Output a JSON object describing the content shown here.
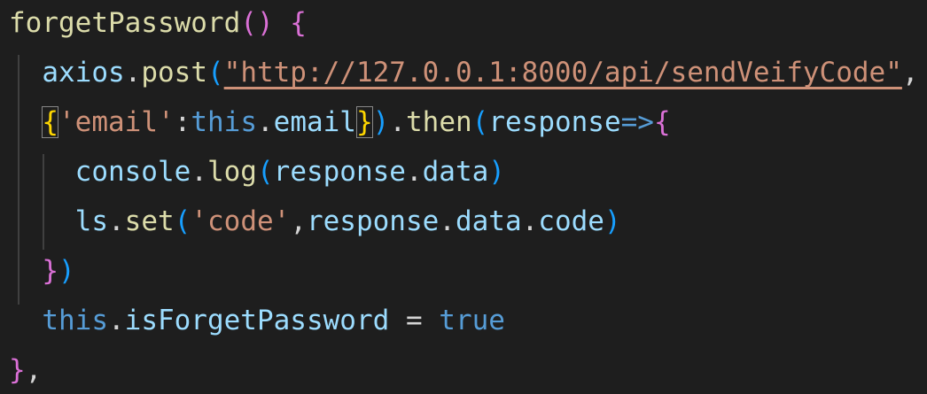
{
  "editor": {
    "lines": [
      {
        "tokens": [
          {
            "t": "forgetPassword",
            "c": "tok-fn"
          },
          {
            "t": "()",
            "c": "tok-b2"
          },
          {
            "t": " ",
            "c": "tok-punct"
          },
          {
            "t": "{",
            "c": "tok-b2"
          }
        ]
      },
      {
        "tokens": [
          {
            "t": "  ",
            "c": "tok-punct"
          },
          {
            "t": "axios",
            "c": "tok-var"
          },
          {
            "t": ".",
            "c": "tok-punct"
          },
          {
            "t": "post",
            "c": "tok-fn"
          },
          {
            "t": "(",
            "c": "tok-b3"
          },
          {
            "t": "\"http://127.0.0.1:8000/api/sendVeifyCode\"",
            "c": "tok-str-url"
          },
          {
            "t": ",",
            "c": "tok-punct"
          }
        ]
      },
      {
        "tokens": [
          {
            "t": "  ",
            "c": "tok-punct"
          },
          {
            "t": "{",
            "c": "tok-b1 bracket-match"
          },
          {
            "t": "'email'",
            "c": "tok-str"
          },
          {
            "t": ":",
            "c": "tok-punct"
          },
          {
            "t": "this",
            "c": "tok-kw"
          },
          {
            "t": ".",
            "c": "tok-punct"
          },
          {
            "t": "email",
            "c": "tok-var"
          },
          {
            "t": "}",
            "c": "tok-b1 bracket-match"
          },
          {
            "t": ")",
            "c": "tok-b3"
          },
          {
            "t": ".",
            "c": "tok-punct"
          },
          {
            "t": "then",
            "c": "tok-fn"
          },
          {
            "t": "(",
            "c": "tok-b3"
          },
          {
            "t": "response",
            "c": "tok-var"
          },
          {
            "t": "=>",
            "c": "tok-arrow"
          },
          {
            "t": "{",
            "c": "tok-b2"
          }
        ]
      },
      {
        "tokens": [
          {
            "t": "    ",
            "c": "tok-punct"
          },
          {
            "t": "console",
            "c": "tok-var"
          },
          {
            "t": ".",
            "c": "tok-punct"
          },
          {
            "t": "log",
            "c": "tok-fn"
          },
          {
            "t": "(",
            "c": "tok-b3"
          },
          {
            "t": "response",
            "c": "tok-var"
          },
          {
            "t": ".",
            "c": "tok-punct"
          },
          {
            "t": "data",
            "c": "tok-var"
          },
          {
            "t": ")",
            "c": "tok-b3"
          }
        ]
      },
      {
        "tokens": [
          {
            "t": "    ",
            "c": "tok-punct"
          },
          {
            "t": "ls",
            "c": "tok-var"
          },
          {
            "t": ".",
            "c": "tok-punct"
          },
          {
            "t": "set",
            "c": "tok-fn"
          },
          {
            "t": "(",
            "c": "tok-b3"
          },
          {
            "t": "'code'",
            "c": "tok-str"
          },
          {
            "t": ",",
            "c": "tok-punct"
          },
          {
            "t": "response",
            "c": "tok-var"
          },
          {
            "t": ".",
            "c": "tok-punct"
          },
          {
            "t": "data",
            "c": "tok-var"
          },
          {
            "t": ".",
            "c": "tok-punct"
          },
          {
            "t": "code",
            "c": "tok-var"
          },
          {
            "t": ")",
            "c": "tok-b3"
          }
        ]
      },
      {
        "tokens": [
          {
            "t": "  ",
            "c": "tok-punct"
          },
          {
            "t": "}",
            "c": "tok-b2"
          },
          {
            "t": ")",
            "c": "tok-b3"
          }
        ]
      },
      {
        "tokens": [
          {
            "t": "  ",
            "c": "tok-punct"
          },
          {
            "t": "this",
            "c": "tok-kw"
          },
          {
            "t": ".",
            "c": "tok-punct"
          },
          {
            "t": "isForgetPassword",
            "c": "tok-var"
          },
          {
            "t": " = ",
            "c": "tok-punct"
          },
          {
            "t": "true",
            "c": "tok-kw"
          }
        ]
      },
      {
        "tokens": [
          {
            "t": "}",
            "c": "tok-b2"
          },
          {
            "t": ",",
            "c": "tok-punct"
          }
        ]
      }
    ]
  },
  "colors": {
    "background": "#1e1e1e",
    "function": "#dcdcaa",
    "variable": "#9cdcfe",
    "string": "#ce9178",
    "keyword": "#569cd6",
    "bracket_gold": "#ffd700",
    "bracket_orchid": "#da70d6",
    "bracket_blue": "#179fff"
  }
}
